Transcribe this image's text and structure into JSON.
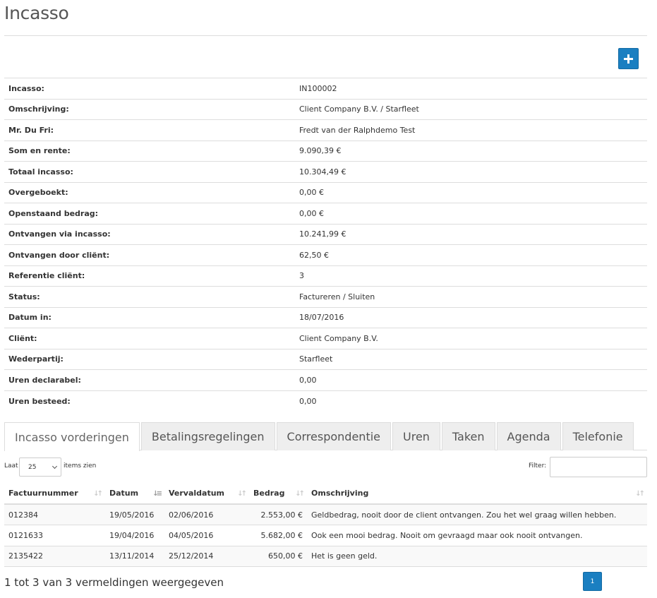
{
  "page": {
    "title": "Incasso"
  },
  "details": [
    {
      "label": "Incasso:",
      "value": "IN100002"
    },
    {
      "label": "Omschrijving:",
      "value": "Client Company B.V. / Starfleet"
    },
    {
      "label": "Mr. Du Fri:",
      "value": "Fredt van der Ralphdemo Test"
    },
    {
      "label": "Som en rente:",
      "value": "9.090,39 €"
    },
    {
      "label": "Totaal incasso:",
      "value": "10.304,49 €"
    },
    {
      "label": "Overgeboekt:",
      "value": "0,00 €"
    },
    {
      "label": "Openstaand bedrag:",
      "value": "0,00 €"
    },
    {
      "label": "Ontvangen via incasso:",
      "value": "10.241,99 €"
    },
    {
      "label": "Ontvangen door cliënt:",
      "value": "62,50 €"
    },
    {
      "label": "Referentie cliënt:",
      "value": "3"
    },
    {
      "label": "Status:",
      "value": "Factureren / Sluiten"
    },
    {
      "label": "Datum in:",
      "value": "18/07/2016"
    },
    {
      "label": "Cliënt:",
      "value": "Client Company B.V."
    },
    {
      "label": "Wederpartij:",
      "value": "Starfleet"
    },
    {
      "label": "Uren declarabel:",
      "value": "0,00"
    },
    {
      "label": "Uren besteed:",
      "value": "0,00"
    }
  ],
  "tabs": [
    {
      "label": "Incasso vorderingen"
    },
    {
      "label": "Betalingsregelingen"
    },
    {
      "label": "Correspondentie"
    },
    {
      "label": "Uren"
    },
    {
      "label": "Taken"
    },
    {
      "label": "Agenda"
    },
    {
      "label": "Telefonie"
    }
  ],
  "table_controls": {
    "length_prefix": "Laat",
    "length_value": "25",
    "length_suffix": "items zien",
    "filter_label": "Filter:"
  },
  "table": {
    "columns": [
      "Factuurnummer",
      "Datum",
      "Vervaldatum",
      "Bedrag",
      "Omschrijving"
    ],
    "rows": [
      [
        "012384",
        "19/05/2016",
        "02/06/2016",
        "2.553,00 €",
        "Geldbedrag, nooit door de client ontvangen. Zou het wel graag willen hebben."
      ],
      [
        "0121633",
        "19/04/2016",
        "04/05/2016",
        "5.682,00 €",
        "Ook een mooi bedrag. Nooit om gevraagd maar ook nooit ontvangen."
      ],
      [
        "2135422",
        "13/11/2014",
        "25/12/2014",
        "650,00 €",
        "Het is geen geld."
      ]
    ]
  },
  "footer": {
    "info": "1 tot 3 van 3 vermeldingen weergegeven",
    "page_label": "1"
  },
  "colors": {
    "primary": "#1a7fc1",
    "border": "#dddddd",
    "tab_bg": "#eeeeee"
  },
  "icons": {
    "add": "plus-icon",
    "sort": "sort-icon",
    "select": "chevron-down-icon"
  }
}
